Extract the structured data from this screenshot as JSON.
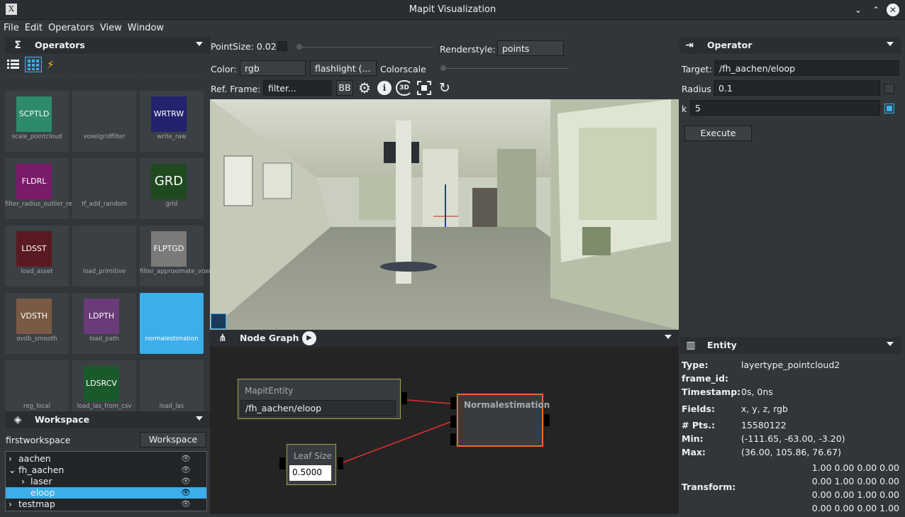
{
  "window": {
    "title": "Mapit Visualization",
    "min_icon": "chevron-down-icon",
    "max_icon": "chevron-up-icon",
    "close_icon": "close-icon",
    "app_icon_glyph": "X"
  },
  "menu": [
    "File",
    "Edit",
    "Operators",
    "View",
    "Window"
  ],
  "operators_panel": {
    "title": "Operators",
    "view_icons": [
      "list-view-icon",
      "grid-view-icon",
      "lightning-icon"
    ],
    "tiles": [
      {
        "label": "SCPTLD",
        "caption": "scale_pointcloud",
        "color": "#2e8b6a"
      },
      {
        "label": "",
        "caption": "voxelgridfilter",
        "color": "#3b4045"
      },
      {
        "label": "WRTRW",
        "caption": "write_raw",
        "color": "#22226e"
      },
      {
        "label": "FLDRL",
        "caption": "filter_radius_outlier_removal",
        "color": "#7a1a6a"
      },
      {
        "label": "",
        "caption": "tf_add_random",
        "color": "#888888"
      },
      {
        "label": "GRD",
        "caption": "grid",
        "color": "#1f4a1f"
      },
      {
        "label": "LDSST",
        "caption": "load_asset",
        "color": "#5a1a22"
      },
      {
        "label": "",
        "caption": "load_primitive",
        "color": "#3b4045"
      },
      {
        "label": "FLPTGD",
        "caption": "filter_approximate_voxel_grid",
        "color": "#7a7a7a"
      },
      {
        "label": "VDSTH",
        "caption": "ovdb_smooth",
        "color": "#7a5a44"
      },
      {
        "label": "LDPTH",
        "caption": "load_path",
        "color": "#6a3a7a"
      },
      {
        "label": "",
        "caption": "normalestimation",
        "color": "#3daee9"
      },
      {
        "label": "",
        "caption": "reg_local",
        "color": "#3b4045"
      },
      {
        "label": "LDSRCV",
        "caption": "load_las_from_csv",
        "color": "#1a5a2a"
      },
      {
        "label": "",
        "caption": "load_las",
        "color": "#3b4045"
      }
    ]
  },
  "workspace_panel": {
    "title": "Workspace",
    "name": "firstworkspace",
    "button": "Workspace",
    "tree": [
      {
        "label": "aachen",
        "expander": "›",
        "indent": 0,
        "selected": false
      },
      {
        "label": "fh_aachen",
        "expander": "⌄",
        "indent": 0,
        "selected": false
      },
      {
        "label": "laser",
        "expander": "›",
        "indent": 1,
        "selected": false
      },
      {
        "label": "eloop",
        "expander": "",
        "indent": 1,
        "selected": true
      },
      {
        "label": "testmap",
        "expander": "›",
        "indent": 0,
        "selected": false
      }
    ]
  },
  "viewer_toolbar": {
    "pointsize_label": "PointSize: 0.02",
    "renderstyle_label": "Renderstyle:",
    "renderstyle_value": "points",
    "color_label": "Color:",
    "color_value": "rgb",
    "flashlight_value": "flashlight (...",
    "colorscale_label": "Colorscale",
    "refframe_label": "Ref. Frame:",
    "refframe_value": "filter...",
    "bb_button": "BB",
    "tool_icons": [
      "gear-icon",
      "info-icon",
      "3d-rotate-icon",
      "focus-frame-icon",
      "reset-view-icon"
    ],
    "tool_3d_text": "3D"
  },
  "node_graph": {
    "title": "Node Graph",
    "nodes": {
      "entity": {
        "title": "MapitEntity",
        "value": "/fh_aachen/eloop"
      },
      "leaf": {
        "title": "Leaf Size",
        "value": "0.5000"
      },
      "normal": {
        "title": "Normalestimation"
      }
    }
  },
  "operator_panel": {
    "title": "Operator",
    "target_label": "Target:",
    "target_value": "/fh_aachen/eloop",
    "radius_label": "Radius",
    "radius_value": "0.1",
    "k_label": "k",
    "k_value": "5",
    "execute": "Execute"
  },
  "entity_panel": {
    "title": "Entity",
    "rows": [
      {
        "label": "Type:",
        "value": "layertype_pointcloud2"
      },
      {
        "label": "frame_id:",
        "value": ""
      },
      {
        "label": "Timestamp:",
        "value": "0s, 0ns"
      },
      {
        "label": "Fields:",
        "value": "x, y, z, rgb"
      },
      {
        "label": "# Pts.:",
        "value": "15580122"
      },
      {
        "label": "Min:",
        "value": "(-111.65, -63.00, -3.20)"
      },
      {
        "label": "Max:",
        "value": "(36.00, 105.86, 76.67)"
      }
    ],
    "transform_label": "Transform:",
    "transform": [
      "1.00 0.00 0.00 0.00",
      "0.00 1.00 0.00 0.00",
      "0.00 0.00 1.00 0.00",
      "0.00 0.00 0.00 1.00"
    ]
  },
  "colors": {
    "accent": "#3daee9",
    "bg": "#31363b",
    "node_border": "#a0a64a",
    "selected_node_border": "#e8692a",
    "link": "#e03030"
  }
}
